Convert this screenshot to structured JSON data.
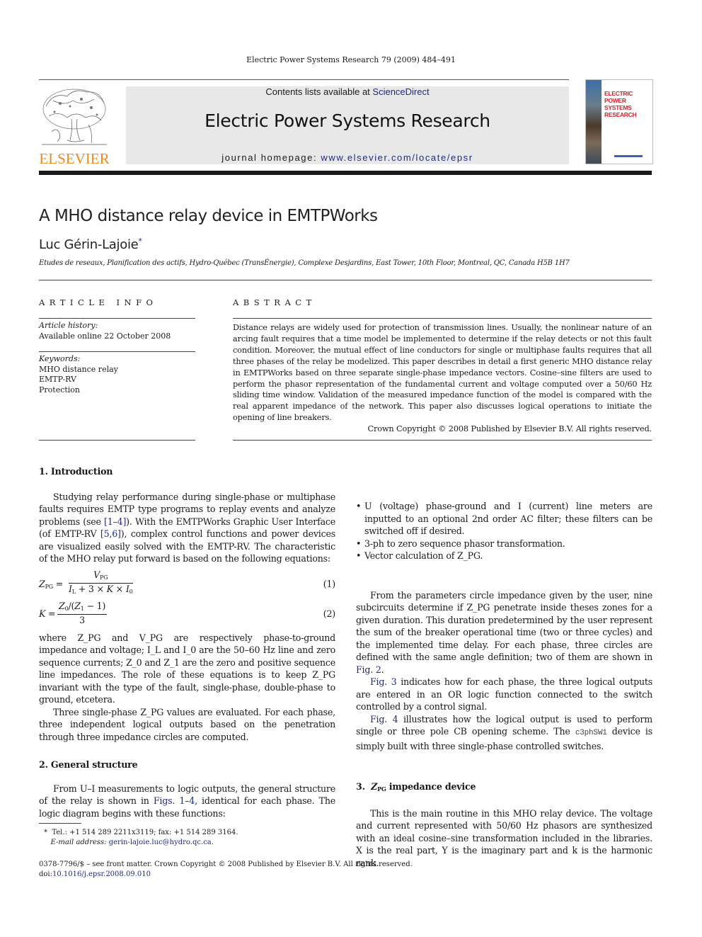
{
  "header": {
    "running_head": "Electric Power Systems Research 79 (2009) 484–491",
    "contents_prefix": "Contents lists available at ",
    "contents_link": "ScienceDirect",
    "journal_title": "Electric Power Systems Research",
    "homepage_prefix": "journal homepage: ",
    "homepage_link": "www.elsevier.com/locate/epsr",
    "publisher_logo_text": "ELSEVIER",
    "cover_title_line1": "ELECTRIC POWER",
    "cover_title_line2": "SYSTEMS RESEARCH",
    "colors": {
      "elsevier_orange": "#f08a1e",
      "link_blue": "#1f2a80",
      "cover_red": "#c8282d",
      "banner_gray": "#e8e8e8"
    }
  },
  "article": {
    "title": "A MHO distance relay device in EMTPWorks",
    "author": "Luc Gérin-Lajoie",
    "author_mark": "*",
    "affiliation": "Etudes de reseaux, Planification des actifs, Hydro-Québec (TransÉnergie), Complexe Desjardins, East Tower, 10th Floor, Montreal, QC, Canada H5B 1H7"
  },
  "article_info": {
    "heading": "ARTICLE INFO",
    "history_label": "Article history:",
    "history_value": "Available online 22 October 2008",
    "keywords_label": "Keywords:",
    "keywords": [
      "MHO distance relay",
      "EMTP-RV",
      "Protection"
    ]
  },
  "abstract": {
    "heading": "ABSTRACT",
    "text": "Distance relays are widely used for protection of transmission lines. Usually, the nonlinear nature of an arcing fault requires that a time model be implemented to determine if the relay detects or not this fault condition. Moreover, the mutual effect of line conductors for single or multiphase faults requires that all three phases of the relay be modelized. This paper describes in detail a first generic MHO distance relay in EMTPWorks based on three separate single-phase impedance vectors. Cosine–sine filters are used to perform the phasor representation of the fundamental current and voltage computed over a 50/60 Hz sliding time window. Validation of the measured impedance function of the model is compared with the real apparent impedance of the network. This paper also discusses logical operations to initiate the opening of line breakers.",
    "copyright": "Crown Copyright © 2008 Published by Elsevier B.V. All rights reserved."
  },
  "sections": {
    "intro_heading": "1.  Introduction",
    "intro_p1_a": "Studying relay performance during single-phase or multiphase faults requires EMTP type programs to replay events and analyze problems (see ",
    "intro_p1_ref1": "[1–4]",
    "intro_p1_b": "). With the EMTPWorks Graphic User Interface (of EMTP-RV ",
    "intro_p1_ref2": "[5,6]",
    "intro_p1_c": "), complex control functions and power devices are visualized easily solved with the EMTP-RV. The characteristic of the MHO relay put forward is based on the following equations:",
    "eq1_number": "(1)",
    "eq2_number": "(2)",
    "intro_p2": "where Z_PG and V_PG are respectively phase-to-ground impedance and voltage; I_L and I_0 are the 50–60 Hz line and zero sequence currents; Z_0 and Z_1 are the zero and positive sequence line impedances. The role of these equations is to keep Z_PG invariant with the type of the fault, single-phase, double-phase to ground, etcetera.",
    "intro_p3": "Three single-phase Z_PG values are evaluated. For each phase, three independent logical outputs based on the penetration through three impedance circles are computed.",
    "general_heading": "2.  General structure",
    "general_p1_a": "From U–I measurements to logic outputs, the general structure of the relay is shown in ",
    "general_p1_ref": "Figs. 1–4",
    "general_p1_b": ", identical for each phase. The logic diagram begins with these functions:",
    "bullets": [
      "U (voltage) phase-ground and I (current) line meters are inputted to an optional 2nd order AC filter; these filters can be switched off if desired.",
      "3-ph to zero sequence phasor transformation.",
      "Vector calculation of Z_PG."
    ],
    "general_p2_a": "From the parameters circle impedance given by the user, nine subcircuits determine if Z_PG penetrate inside theses zones for a given duration. This duration predetermined by the user represent the sum of the breaker operational time (two or three cycles) and the implemented time delay. For each phase, three circles are defined with the same angle definition; two of them are shown in ",
    "general_p2_ref": "Fig. 2",
    "general_p3_ref": "Fig. 3",
    "general_p3": " indicates how for each phase, the three logical outputs are entered in an OR logic function connected to the switch controlled by a control signal.",
    "general_p4_ref": "Fig. 4",
    "general_p4_a": " illustrates how the logical output is used to perform single or three pole CB opening scheme. The ",
    "general_p4_code": "c3phSW1",
    "general_p4_b": " device is simply built with three single-phase controlled switches.",
    "zpg_heading_num": "3.",
    "zpg_heading_rest": " impedance device",
    "zpg_p1": "This is the main routine in this MHO relay device. The voltage and current represented with 50/60 Hz phasors are synthesized with an ideal cosine–sine transformation included in the libraries. X is the real part, Y is the imaginary part and k is the harmonic rank."
  },
  "footnote": {
    "mark": "*",
    "contact": "Tel.: +1 514 289 2211x3119; fax: +1 514 289 3164.",
    "email_label": "E-mail address: ",
    "email": "gerin-lajoie.luc@hydro.qc.ca"
  },
  "front_matter": {
    "issn_line": "0378-7796/$ – see front matter. Crown Copyright © 2008 Published by Elsevier B.V. All rights reserved.",
    "doi_label": "doi:",
    "doi": "10.1016/j.epsr.2008.09.010"
  }
}
